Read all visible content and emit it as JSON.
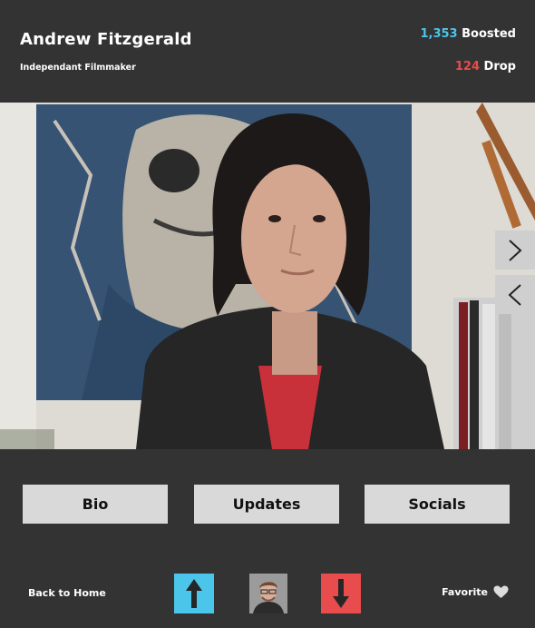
{
  "profile": {
    "name": "Andrew Fitzgerald",
    "role": "Independant Filmmaker"
  },
  "stats": {
    "boosted_count": "1,353",
    "boosted_label": "Boosted",
    "drop_count": "124",
    "drop_label": "Drop"
  },
  "photo": {
    "next_icon": "chevron-right-icon",
    "prev_icon": "chevron-left-icon"
  },
  "tabs": [
    {
      "label": "Bio"
    },
    {
      "label": "Updates"
    },
    {
      "label": "Socials"
    }
  ],
  "footer": {
    "back_label": "Back to Home",
    "favorite_label": "Favorite",
    "favorite_icon": "heart-icon",
    "upvote_icon": "arrow-up-icon",
    "downvote_icon": "arrow-down-icon"
  },
  "colors": {
    "background": "#333333",
    "boost": "#4bc6ea",
    "drop": "#e84c4c",
    "button": "#d9d9d9"
  }
}
